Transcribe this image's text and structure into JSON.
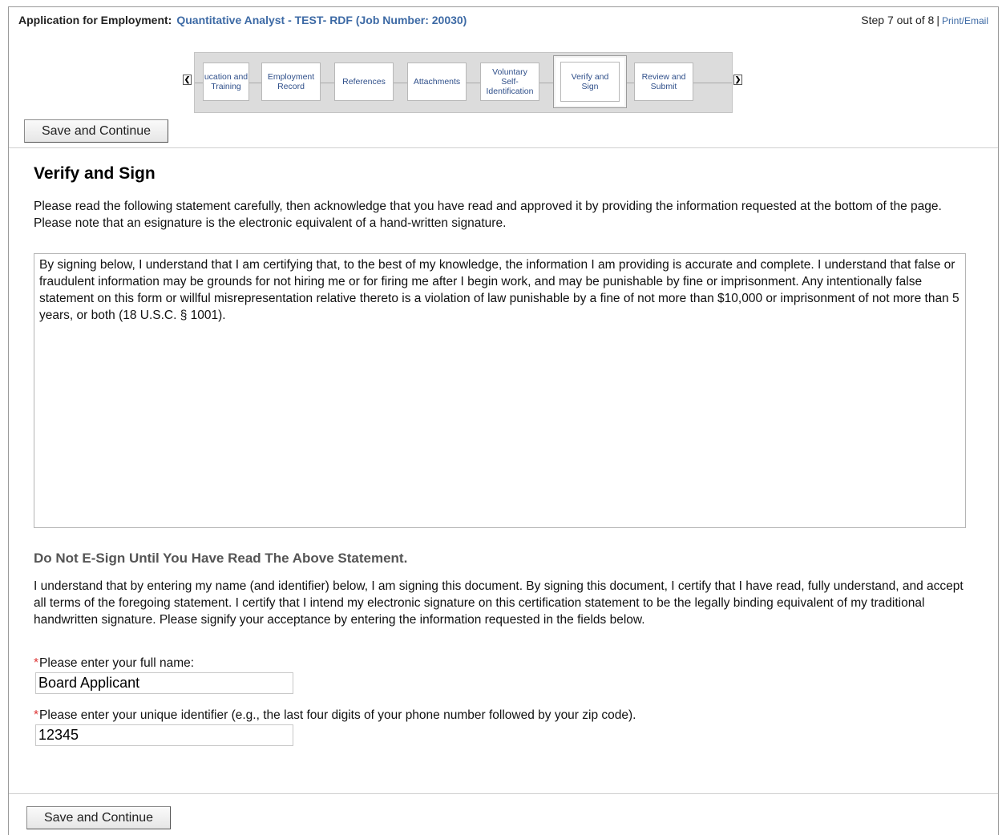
{
  "header": {
    "app_label": "Application for Employment:",
    "job_title": "Quantitative Analyst - TEST- RDF (Job Number: 20030)",
    "step_text": "Step 7 out of 8",
    "separator": "|",
    "print_email": "Print/Email"
  },
  "steps": [
    {
      "label": "ucation and\nTraining",
      "active": false
    },
    {
      "label": "Employment\nRecord",
      "active": false
    },
    {
      "label": "References",
      "active": false
    },
    {
      "label": "Attachments",
      "active": false
    },
    {
      "label": "Voluntary\nSelf-\nIdentification",
      "active": false
    },
    {
      "label": "Verify and\nSign",
      "active": true
    },
    {
      "label": "Review and\nSubmit",
      "active": false
    }
  ],
  "icons": {
    "prev": "chevron-left-icon",
    "next": "chevron-right-icon",
    "required": "asterisk-icon"
  },
  "buttons": {
    "save_continue": "Save and Continue"
  },
  "main": {
    "title": "Verify and Sign",
    "intro": "Please read the following statement carefully, then acknowledge that you have read and approved it by providing the information requested at the bottom of the page. Please note that an esignature is the electronic equivalent of a hand-written signature.",
    "statement": "By signing below, I understand that I am certifying that, to the best of my knowledge, the information I am providing is accurate and complete. I understand that false or fraudulent information may be grounds for not hiring me or for firing me after I begin work, and may be punishable by fine or imprisonment.  Any intentionally false statement on this form or willful misrepresentation relative thereto is a violation of law punishable by a fine of not more than $10,000 or imprisonment of not more than 5 years, or both (18 U.S.C. § 1001).",
    "warning": "Do Not E-Sign Until You Have Read The Above Statement.",
    "consent": "I understand that by entering my name (and identifier) below, I am signing this document. By signing this document, I certify that I have read, fully understand, and accept all terms of the foregoing statement. I certify that I intend my electronic signature on this certification statement to be the legally binding equivalent of my traditional handwritten signature. Please signify your acceptance by entering the information requested in the fields below."
  },
  "fields": {
    "name_label": "Please enter your full name:",
    "name_value": "Board Applicant",
    "id_label": "Please enter your unique identifier (e.g., the last four digits of your phone number followed by your zip code).",
    "id_value": "12345"
  },
  "colors": {
    "link": "#3d6aa5",
    "required": "#dd3333",
    "warning_text": "#555555"
  }
}
